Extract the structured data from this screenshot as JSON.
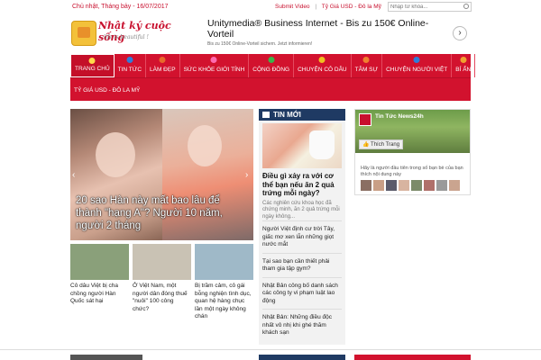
{
  "topbar": {
    "date": "Chủ nhật, Tháng bảy - 16/07/2017",
    "links": [
      "Submit Video",
      "Tỷ Giá USD - Đô la Mỹ"
    ],
    "search_placeholder": "Nhập từ khóa..."
  },
  "logo": {
    "title": "Nhật ký cuộc sống",
    "subtitle": "life is beautiful !"
  },
  "ad": {
    "title": "Unitymedia® Business Internet - Bis zu 150€ Online-Vorteil",
    "subtitle": "Bis zu 150€ Online-Vorteil sichern. Jetzt informieren!",
    "button": "›"
  },
  "nav": {
    "row1": [
      {
        "label": "TRANG CHỦ",
        "active": true,
        "icon_color": "#ffd84a"
      },
      {
        "label": "TIN TỨC",
        "active": false,
        "icon_color": "#2f7dd8"
      },
      {
        "label": "LÀM ĐẸP",
        "active": false,
        "icon_color": "#e86a2b"
      },
      {
        "label": "SỨC KHỎE GIỚI TÍNH",
        "active": false,
        "icon_color": "#ff6bb0"
      },
      {
        "label": "CỘNG ĐỒNG",
        "active": false,
        "icon_color": "#3bb34a"
      },
      {
        "label": "CHUYỆN CÔ DÂU",
        "active": false,
        "icon_color": "#f0c020"
      },
      {
        "label": "TÂM SỰ",
        "active": false,
        "icon_color": "#f08030"
      },
      {
        "label": "CHUYỆN NGƯỜI VIỆT",
        "active": false,
        "icon_color": "#2f7dd8"
      },
      {
        "label": "BÍ ẨN",
        "active": false,
        "icon_color": "#f0a030"
      }
    ],
    "row2": [
      {
        "label": "TỶ GIÁ USD - ĐÔ LA MỸ"
      }
    ]
  },
  "feature": {
    "caption": "20 sao Hàn này mất bao lâu để thành \"hạng A\"? Người 10 năm, người 2 tháng"
  },
  "thumbs": [
    {
      "title": "Cô dâu Việt bị cha chồng người Hàn Quốc sát hại",
      "color": "#8aa07a"
    },
    {
      "title": "Ở Việt Nam, một người dân đóng thuế \"nuôi\" 100 công chức?",
      "color": "#c9c2b4"
    },
    {
      "title": "Bị trầm cảm, cô gái bỗng nghiện tình dục, quan hệ hàng chục lần một ngày không chán",
      "color": "#9fb9c8"
    }
  ],
  "news": {
    "header": "TIN MỚI",
    "main_title": "Điều gì xảy ra với cơ thể bạn nếu ăn 2 quả trứng mỗi ngày?",
    "main_desc": "Các nghiên cứu khoa học đã chứng minh, ăn 2 quả trứng mỗi ngày không...",
    "items": [
      "Người Việt định cư trời Tây, giấc mơ xen lẫn những giọt nước mắt",
      "Tại sao bạn cần thiết phải tham gia tập gym?",
      "Nhật Bản công bố danh sách các công ty vi phạm luật lao động",
      "Nhật Bản: Những điều độc nhất vô nhị khi ghé thăm khách sạn"
    ]
  },
  "fb": {
    "name": "Tin Tức News24h",
    "like_button": "Thích Trang",
    "text": "Hãy là người đầu tiên trong số bạn bè của bạn thích nội dung này"
  }
}
